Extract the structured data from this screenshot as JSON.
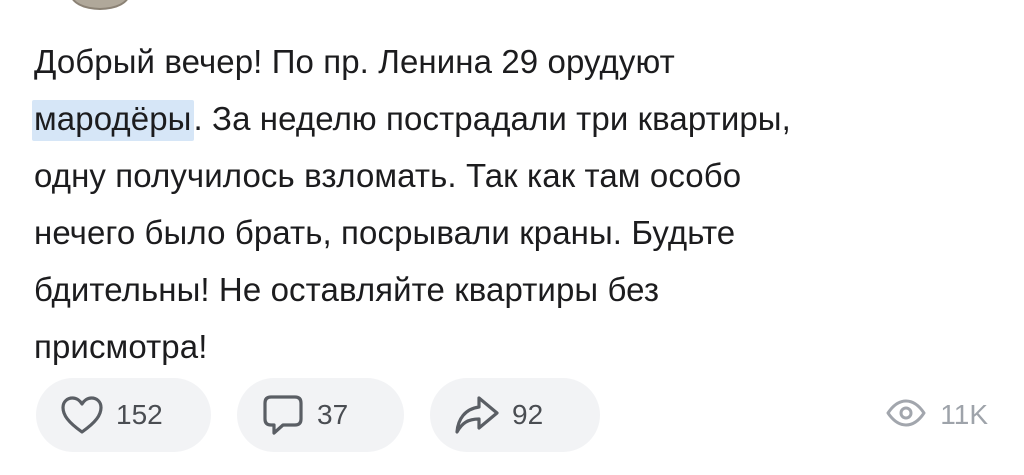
{
  "post": {
    "text_lines": [
      "Добрый вечер! По пр. Ленина 29 орудуют",
      "мародёры",
      ". За неделю пострадали три квартиры,",
      "одну получилось взломать. Так как там особо",
      "нечего было брать, посрывали краны. Будьте",
      "бдительны! Не оставляйте квартиры без",
      "присмотра!"
    ],
    "highlight_color": "#d6e6f7"
  },
  "actions": {
    "like": {
      "icon": "heart-icon",
      "count": "152"
    },
    "comment": {
      "icon": "comment-icon",
      "count": "37"
    },
    "share": {
      "icon": "share-icon",
      "count": "92"
    },
    "views": {
      "icon": "eye-icon",
      "count": "11K"
    }
  },
  "colors": {
    "pill_background": "#f2f3f5",
    "icon": "#5a5e64",
    "views": "#a2a6ad"
  }
}
